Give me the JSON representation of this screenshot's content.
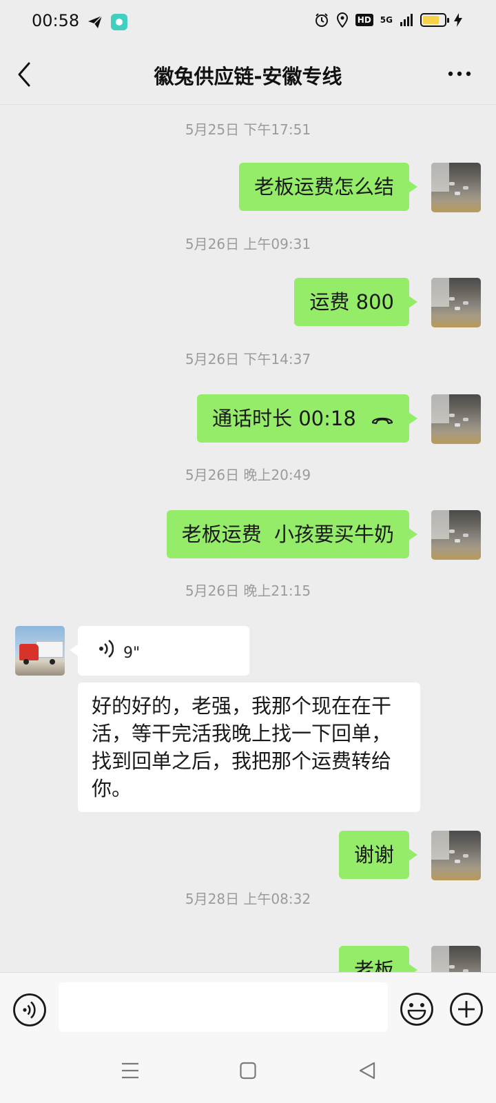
{
  "status_bar": {
    "time": "00:58",
    "hd": "HD",
    "network": "5G",
    "battery_level_fraction": 0.75,
    "icons": [
      "send-icon",
      "app-icon",
      "alarm-icon",
      "location-icon",
      "signal-icon",
      "battery-icon",
      "charging-icon"
    ]
  },
  "header": {
    "title": "徽兔供应链-安徽专线",
    "back_icon": "chevron-left-icon",
    "more_icon": "more-icon"
  },
  "messages": {
    "m1_time": "5月25日 下午17:51",
    "m1_text": "老板运费怎么结",
    "m2_time": "5月26日 上午09:31",
    "m2_text": "运费 800",
    "m3_time": "5月26日 下午14:37",
    "m3_text": "通话时长 00:18",
    "m4_time": "5月26日 晚上20:49",
    "m4_text": "老板运费  小孩要买牛奶",
    "m5_time": "5月26日 晚上21:15",
    "m5_voice": "9\"",
    "m6_text": "好的好的，老强，我那个现在在干活，等干完活我晚上找一下回单，找到回单之后，我把那个运费转给你。",
    "m7_text": "谢谢",
    "m8_time": "5月28日 上午08:32",
    "m8_text": "老板"
  },
  "input_bar": {
    "voice_icon": "voice-icon",
    "emoji_icon": "emoji-icon",
    "plus_icon": "plus-icon",
    "text_value": ""
  },
  "nav_bar": {
    "icons": [
      "menu-icon",
      "home-icon",
      "back-icon"
    ]
  },
  "colors": {
    "background": "#ededed",
    "outgoing_bubble": "#95ec69",
    "incoming_bubble": "#ffffff",
    "timestamp": "#9b9b9b"
  }
}
